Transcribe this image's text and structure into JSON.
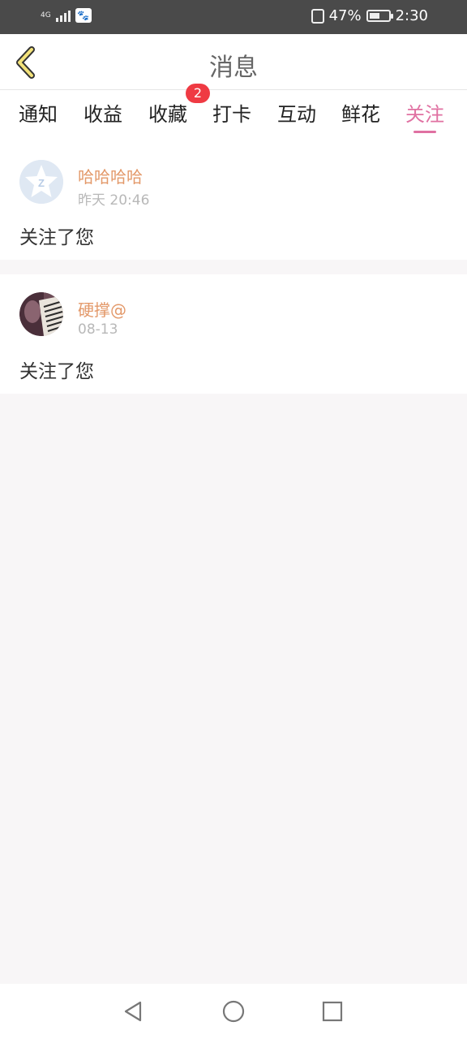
{
  "status_bar": {
    "network": "4G",
    "battery_percent": "47%",
    "time": "2:30",
    "icons": [
      "signal-icon",
      "baidu-app-icon",
      "vibrate-icon",
      "battery-icon"
    ]
  },
  "header": {
    "title": "消息",
    "back_icon": "chevron-left-icon"
  },
  "tabs": [
    {
      "label": "通知",
      "active": false
    },
    {
      "label": "收益",
      "active": false
    },
    {
      "label": "收藏",
      "active": false,
      "badge": "2"
    },
    {
      "label": "打卡",
      "active": false
    },
    {
      "label": "互动",
      "active": false
    },
    {
      "label": "鲜花",
      "active": false
    },
    {
      "label": "关注",
      "active": true
    }
  ],
  "messages": [
    {
      "name": "哈哈哈哈",
      "time": "昨天 20:46",
      "text": "关注了您",
      "avatar": "default-avatar-icon"
    },
    {
      "name": "硬撑@",
      "time": "08-13",
      "text": "关注了您",
      "avatar": "user-photo-avatar"
    }
  ],
  "nav_bar": {
    "icons": [
      "back-triangle-icon",
      "home-circle-icon",
      "recents-square-icon"
    ]
  },
  "colors": {
    "accent": "#e071a2",
    "name": "#e3996a",
    "badge": "#ef3a43",
    "back_arrow": "#f3e27a"
  }
}
